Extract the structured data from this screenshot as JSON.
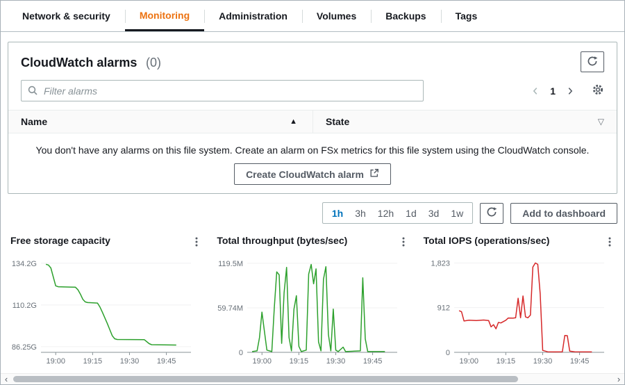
{
  "tabs": {
    "items": [
      {
        "label": "Network & security",
        "active": false
      },
      {
        "label": "Monitoring",
        "active": true
      },
      {
        "label": "Administration",
        "active": false
      },
      {
        "label": "Volumes",
        "active": false
      },
      {
        "label": "Backups",
        "active": false
      },
      {
        "label": "Tags",
        "active": false
      }
    ]
  },
  "alarms": {
    "title": "CloudWatch alarms",
    "count": "(0)",
    "filter_placeholder": "Filter alarms",
    "page": "1",
    "col_name": "Name",
    "col_state": "State",
    "sort_asc_glyph": "▲",
    "sort_none_glyph": "▽",
    "empty_message": "You don't have any alarms on this file system. Create an alarm on FSx metrics for this file system using the CloudWatch console.",
    "create_label": "Create CloudWatch alarm"
  },
  "metrics_toolbar": {
    "ranges": [
      "1h",
      "3h",
      "12h",
      "1d",
      "3d",
      "1w"
    ],
    "active_range": "1h",
    "add_button": "Add to dashboard"
  },
  "colors": {
    "accent_orange": "#ec7211",
    "link_blue": "#0073bb",
    "series_green": "#2ca02c",
    "series_red": "#d62728"
  },
  "charts": [
    {
      "type": "line",
      "title": "Free storage capacity",
      "color": "#2ca02c",
      "ymin": 83,
      "ymax": 136.5,
      "yticks": [
        {
          "v": 134.2,
          "label": "134.2G"
        },
        {
          "v": 110.2,
          "label": "110.2G"
        },
        {
          "v": 86.25,
          "label": "86.25G"
        }
      ],
      "xdomain": [
        "18:54",
        "19:55"
      ],
      "xticks": [
        "19:00",
        "19:15",
        "19:30",
        "19:45"
      ],
      "points": [
        [
          "18:56",
          133.6
        ],
        [
          "18:57",
          133.2
        ],
        [
          "18:58",
          131.5
        ],
        [
          "19:00",
          121.2
        ],
        [
          "19:01",
          120.7
        ],
        [
          "19:06",
          120.5
        ],
        [
          "19:08",
          120.4
        ],
        [
          "19:09",
          119.0
        ],
        [
          "19:10",
          116.5
        ],
        [
          "19:11",
          113.5
        ],
        [
          "19:12",
          112.0
        ],
        [
          "19:13",
          111.6
        ],
        [
          "19:17",
          111.3
        ],
        [
          "19:18",
          109.0
        ],
        [
          "19:19",
          106.0
        ],
        [
          "19:21",
          99.5
        ],
        [
          "19:22",
          96.0
        ],
        [
          "19:23",
          92.5
        ],
        [
          "19:24",
          90.8
        ],
        [
          "19:25",
          90.4
        ],
        [
          "19:36",
          90.3
        ],
        [
          "19:38",
          88.0
        ],
        [
          "19:39",
          87.4
        ],
        [
          "19:49",
          87.2
        ]
      ]
    },
    {
      "type": "line",
      "title": "Total throughput (bytes/sec)",
      "color": "#2ca02c",
      "ymin": 0,
      "ymax": 125,
      "yticks": [
        {
          "v": 119.5,
          "label": "119.5M"
        },
        {
          "v": 59.74,
          "label": "59.74M"
        },
        {
          "v": 0,
          "label": "0"
        }
      ],
      "xdomain": [
        "18:54",
        "19:55"
      ],
      "xticks": [
        "19:00",
        "19:15",
        "19:30",
        "19:45"
      ],
      "points": [
        [
          "18:56",
          1
        ],
        [
          "18:58",
          2
        ],
        [
          "18:59",
          20
        ],
        [
          "19:00",
          54
        ],
        [
          "19:01",
          28
        ],
        [
          "19:02",
          3
        ],
        [
          "19:04",
          1
        ],
        [
          "19:05",
          60
        ],
        [
          "19:06",
          108
        ],
        [
          "19:07",
          104
        ],
        [
          "19:08",
          12
        ],
        [
          "19:09",
          80
        ],
        [
          "19:10",
          114
        ],
        [
          "19:11",
          20
        ],
        [
          "19:12",
          2
        ],
        [
          "19:13",
          58
        ],
        [
          "19:14",
          76
        ],
        [
          "19:15",
          8
        ],
        [
          "19:16",
          1
        ],
        [
          "19:18",
          3
        ],
        [
          "19:19",
          105
        ],
        [
          "19:20",
          118
        ],
        [
          "19:21",
          92
        ],
        [
          "19:22",
          112
        ],
        [
          "19:23",
          14
        ],
        [
          "19:24",
          2
        ],
        [
          "19:25",
          98
        ],
        [
          "19:26",
          115
        ],
        [
          "19:27",
          24
        ],
        [
          "19:28",
          2
        ],
        [
          "19:29",
          58
        ],
        [
          "19:30",
          3
        ],
        [
          "19:31",
          1
        ],
        [
          "19:33",
          7
        ],
        [
          "19:34",
          1
        ],
        [
          "19:40",
          2
        ],
        [
          "19:41",
          100
        ],
        [
          "19:42",
          18
        ],
        [
          "19:43",
          1
        ],
        [
          "19:50",
          1
        ]
      ]
    },
    {
      "type": "line",
      "title": "Total IOPS (operations/sec)",
      "color": "#d62728",
      "ymin": 0,
      "ymax": 1900,
      "yticks": [
        {
          "v": 1823,
          "label": "1,823"
        },
        {
          "v": 912,
          "label": "912"
        },
        {
          "v": 0,
          "label": "0"
        }
      ],
      "xdomain": [
        "18:54",
        "19:55"
      ],
      "xticks": [
        "19:00",
        "19:15",
        "19:30",
        "19:45"
      ],
      "points": [
        [
          "18:56",
          850
        ],
        [
          "18:57",
          828
        ],
        [
          "18:58",
          640
        ],
        [
          "19:00",
          655
        ],
        [
          "19:03",
          648
        ],
        [
          "19:06",
          660
        ],
        [
          "19:08",
          650
        ],
        [
          "19:09",
          520
        ],
        [
          "19:10",
          565
        ],
        [
          "19:11",
          480
        ],
        [
          "19:12",
          610
        ],
        [
          "19:13",
          600
        ],
        [
          "19:15",
          655
        ],
        [
          "19:16",
          700
        ],
        [
          "19:18",
          698
        ],
        [
          "19:19",
          705
        ],
        [
          "19:20",
          1105
        ],
        [
          "19:21",
          705
        ],
        [
          "19:22",
          1150
        ],
        [
          "19:23",
          725
        ],
        [
          "19:24",
          705
        ],
        [
          "19:25",
          760
        ],
        [
          "19:26",
          1740
        ],
        [
          "19:27",
          1823
        ],
        [
          "19:28",
          1795
        ],
        [
          "19:29",
          1190
        ],
        [
          "19:30",
          40
        ],
        [
          "19:32",
          12
        ],
        [
          "19:35",
          8
        ],
        [
          "19:38",
          12
        ],
        [
          "19:39",
          345
        ],
        [
          "19:40",
          340
        ],
        [
          "19:41",
          25
        ],
        [
          "19:43",
          10
        ],
        [
          "19:50",
          9
        ]
      ]
    }
  ]
}
